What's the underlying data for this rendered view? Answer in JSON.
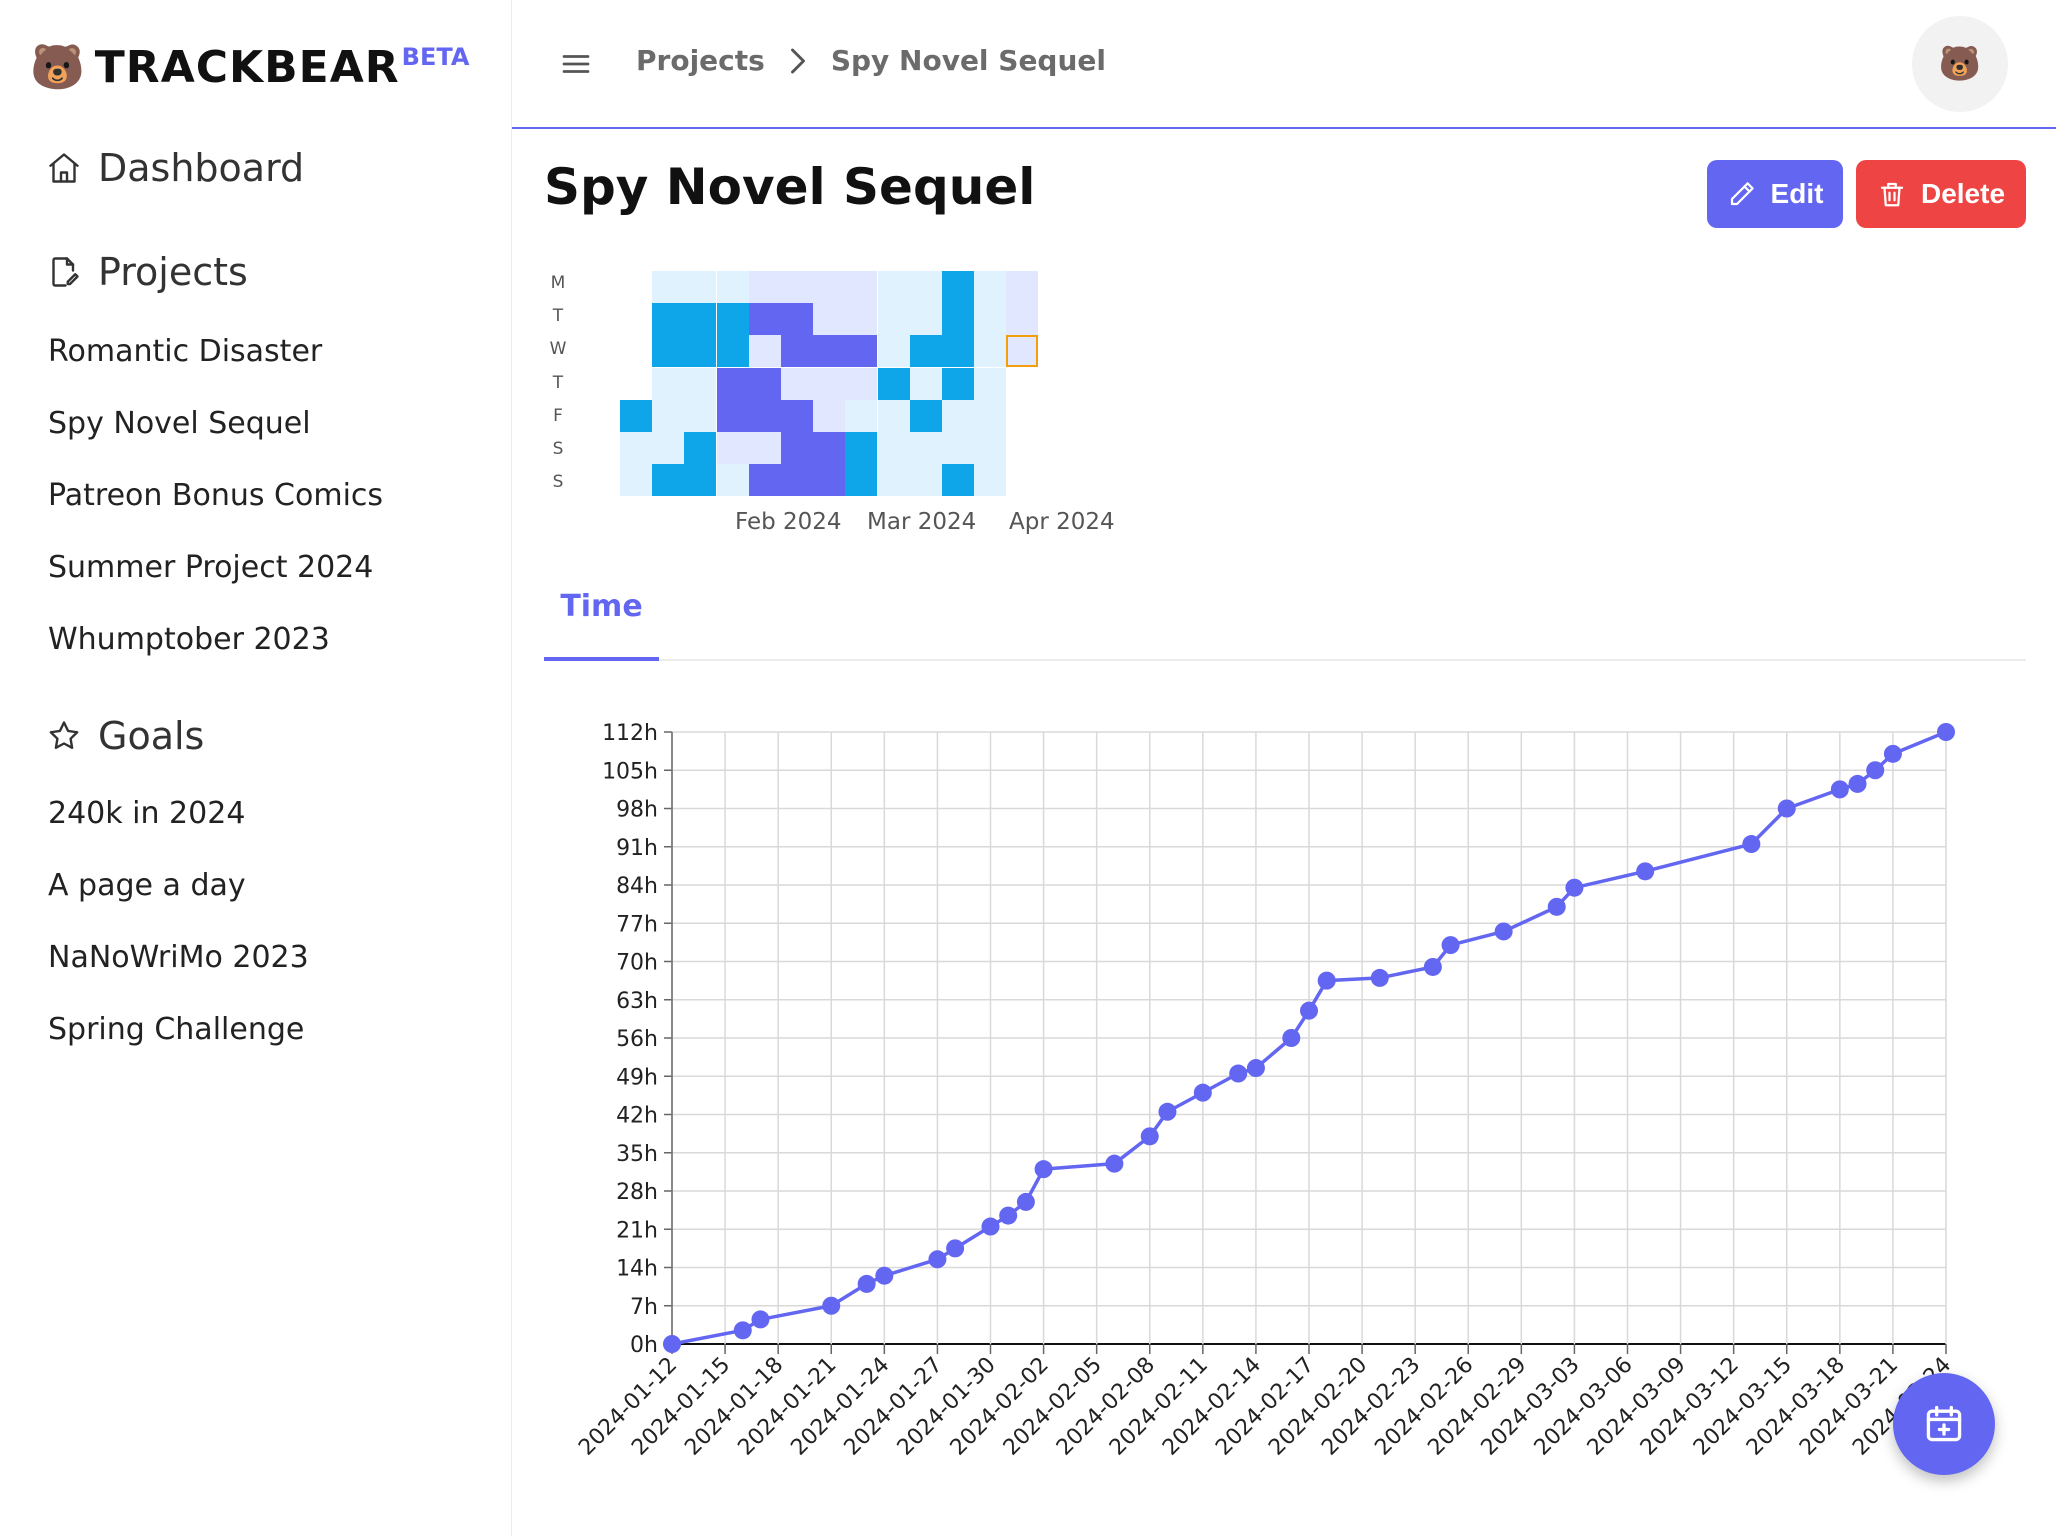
{
  "app": {
    "logo_emoji": "🐻",
    "name": "TRACKBEAR",
    "badge": "BETA"
  },
  "sidebar": {
    "dashboard": "Dashboard",
    "projects_heading": "Projects",
    "projects": [
      "Romantic Disaster",
      "Spy Novel Sequel",
      "Patreon Bonus Comics",
      "Summer Project 2024",
      "Whumptober 2023"
    ],
    "goals_heading": "Goals",
    "goals": [
      "240k in 2024",
      "A page a day",
      "NaNoWriMo 2023",
      "Spring Challenge"
    ]
  },
  "header": {
    "breadcrumb": [
      "Projects",
      "Spy Novel Sequel"
    ],
    "avatar_emoji": "🐻"
  },
  "main": {
    "title": "Spy Novel Sequel",
    "edit_label": "Edit",
    "delete_label": "Delete",
    "tabs": [
      {
        "label": "Time",
        "active": true
      }
    ]
  },
  "heatmap": {
    "day_labels": [
      "M",
      "T",
      "W",
      "T",
      "F",
      "S",
      "S"
    ],
    "month_labels": [
      "Feb 2024",
      "Mar 2024",
      "Apr 2024"
    ],
    "colors": {
      "high": "#0ea5e9",
      "mid": "#6366f1",
      "low_blue": "#e0f2fe",
      "low_purple": "#e0e7ff",
      "today": "#f59e0b"
    },
    "weeks": [
      [
        "",
        "",
        "",
        "",
        "high",
        "lb",
        "lb"
      ],
      [
        "lb",
        "high",
        "high",
        "lb",
        "lb",
        "lb",
        "high"
      ],
      [
        "lb",
        "high",
        "high",
        "lb",
        "lb",
        "high",
        "high"
      ],
      [
        "lb",
        "high",
        "high",
        "mid",
        "mid",
        "lp",
        "lb"
      ],
      [
        "lp",
        "mid",
        "lp",
        "mid",
        "mid",
        "lp",
        "mid"
      ],
      [
        "lp",
        "mid",
        "mid",
        "lp",
        "mid",
        "mid",
        "mid"
      ],
      [
        "lp",
        "lp",
        "mid",
        "lp",
        "lp",
        "mid",
        "mid"
      ],
      [
        "lp",
        "lp",
        "mid",
        "lp",
        "lb",
        "high",
        "high"
      ],
      [
        "lb",
        "lb",
        "lb",
        "high",
        "lb",
        "lb",
        "lb"
      ],
      [
        "lb",
        "lb",
        "high",
        "lb",
        "high",
        "lb",
        "lb"
      ],
      [
        "high",
        "high",
        "high",
        "high",
        "lb",
        "lb",
        "high"
      ],
      [
        "lb",
        "lb",
        "lb",
        "lb",
        "lb",
        "lb",
        "lb"
      ],
      [
        "lp",
        "lp",
        "today",
        "",
        "",
        "",
        ""
      ]
    ]
  },
  "chart_data": {
    "type": "line",
    "title": "",
    "xlabel": "",
    "ylabel": "",
    "color": "#6366f1",
    "grid": true,
    "x_tick_labels": [
      "2024-01-12",
      "2024-01-15",
      "2024-01-18",
      "2024-01-21",
      "2024-01-24",
      "2024-01-27",
      "2024-01-30",
      "2024-02-02",
      "2024-02-05",
      "2024-02-08",
      "2024-02-11",
      "2024-02-14",
      "2024-02-17",
      "2024-02-20",
      "2024-02-23",
      "2024-02-26",
      "2024-02-29",
      "2024-03-03",
      "2024-03-06",
      "2024-03-09",
      "2024-03-12",
      "2024-03-15",
      "2024-03-18",
      "2024-03-21",
      "2024-03-24"
    ],
    "y_tick_labels": [
      "0h",
      "7h",
      "14h",
      "21h",
      "28h",
      "35h",
      "42h",
      "49h",
      "56h",
      "63h",
      "70h",
      "77h",
      "84h",
      "91h",
      "98h",
      "105h",
      "112h"
    ],
    "ylim": [
      0,
      112
    ],
    "xlim": [
      "2024-01-12",
      "2024-03-24"
    ],
    "series": [
      {
        "x": [
          "2024-01-12",
          "2024-01-16",
          "2024-01-17",
          "2024-01-21",
          "2024-01-23",
          "2024-01-24",
          "2024-01-27",
          "2024-01-28",
          "2024-01-30",
          "2024-01-31",
          "2024-02-01",
          "2024-02-02",
          "2024-02-06",
          "2024-02-08",
          "2024-02-09",
          "2024-02-11",
          "2024-02-13",
          "2024-02-14",
          "2024-02-16",
          "2024-02-17",
          "2024-02-18",
          "2024-02-21",
          "2024-02-24",
          "2024-02-25",
          "2024-02-28",
          "2024-03-02",
          "2024-03-03",
          "2024-03-07",
          "2024-03-13",
          "2024-03-15",
          "2024-03-18",
          "2024-03-19",
          "2024-03-20",
          "2024-03-21",
          "2024-03-24"
        ],
        "values": [
          0,
          2.5,
          4.5,
          7,
          11,
          12.5,
          15.5,
          17.5,
          21.5,
          23.5,
          26,
          32,
          33,
          38,
          42.5,
          46,
          49.5,
          50.5,
          56,
          61,
          66.5,
          67,
          69,
          73,
          75.5,
          80,
          83.5,
          86.5,
          91.5,
          98,
          101.5,
          102.5,
          105,
          108,
          112
        ]
      }
    ]
  }
}
